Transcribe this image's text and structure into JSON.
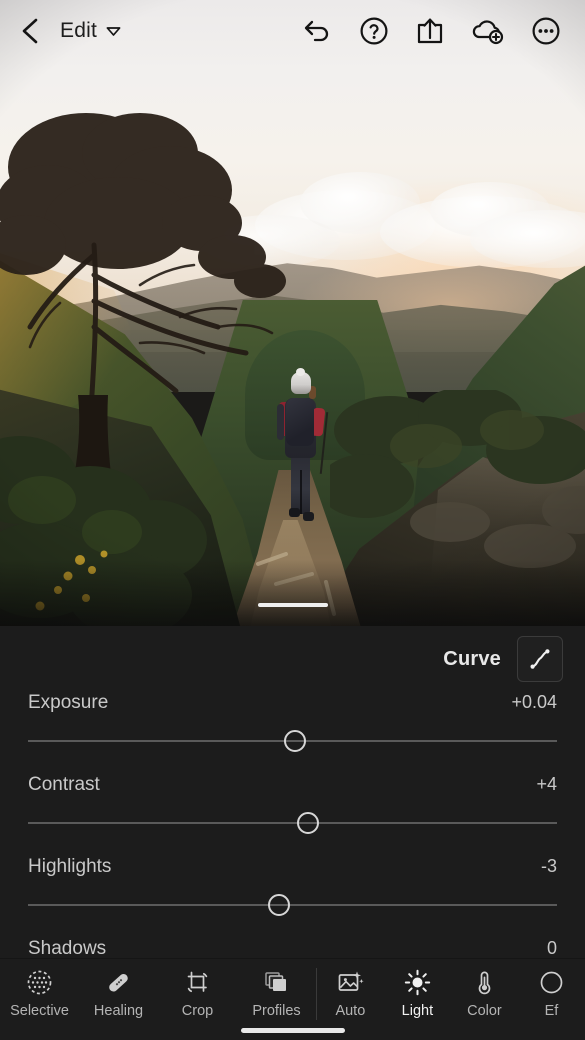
{
  "app": {
    "screen_title": "Edit"
  },
  "topbar": {
    "back_icon": "chevron-left-icon",
    "title": "Edit",
    "title_chevron_icon": "chevron-down-icon",
    "actions": [
      {
        "name": "undo-button",
        "icon": "undo-arrow-icon"
      },
      {
        "name": "help-button",
        "icon": "question-circle-icon"
      },
      {
        "name": "share-button",
        "icon": "share-export-icon"
      },
      {
        "name": "cloud-add-button",
        "icon": "cloud-plus-icon"
      },
      {
        "name": "more-options-button",
        "icon": "ellipsis-circle-icon"
      }
    ]
  },
  "photo": {
    "description": "Hiker with backpack and white beanie walking up a dirt mountain trail at sunset, tree silhouette at left, layered green ridges and bright cloudy sky"
  },
  "panel": {
    "curve_label": "Curve",
    "curve_icon": "tone-curve-icon",
    "sliders": [
      {
        "name": "Exposure",
        "value": "+0.04",
        "position": 50.5
      },
      {
        "name": "Contrast",
        "value": "+4",
        "position": 53.0
      },
      {
        "name": "Highlights",
        "value": "-3",
        "position": 47.5
      },
      {
        "name": "Shadows",
        "value": "0",
        "position": 50.0
      }
    ]
  },
  "toolbar": {
    "left_group": [
      {
        "label": "Selective",
        "icon": "selective-dots-circle-icon",
        "active": false
      },
      {
        "label": "Healing",
        "icon": "healing-bandage-icon",
        "active": false
      },
      {
        "label": "Crop",
        "icon": "crop-rotate-icon",
        "active": false
      },
      {
        "label": "Profiles",
        "icon": "profiles-stack-icon",
        "active": false
      }
    ],
    "right_group": [
      {
        "label": "Auto",
        "icon": "auto-magic-photo-icon",
        "active": false
      },
      {
        "label": "Light",
        "icon": "light-sun-icon",
        "active": true
      },
      {
        "label": "Color",
        "icon": "color-thermometer-icon",
        "active": false
      },
      {
        "label": "Ef",
        "icon": "effects-icon",
        "active": false
      }
    ]
  },
  "colors": {
    "panel_bg": "#1c1c1c",
    "text_primary": "#e8e8e8",
    "text_secondary": "#c9c9c9",
    "slider_track": "#5a5a5a",
    "handle": "#d6d6d6",
    "home_indicator": "#e9e9e9"
  }
}
